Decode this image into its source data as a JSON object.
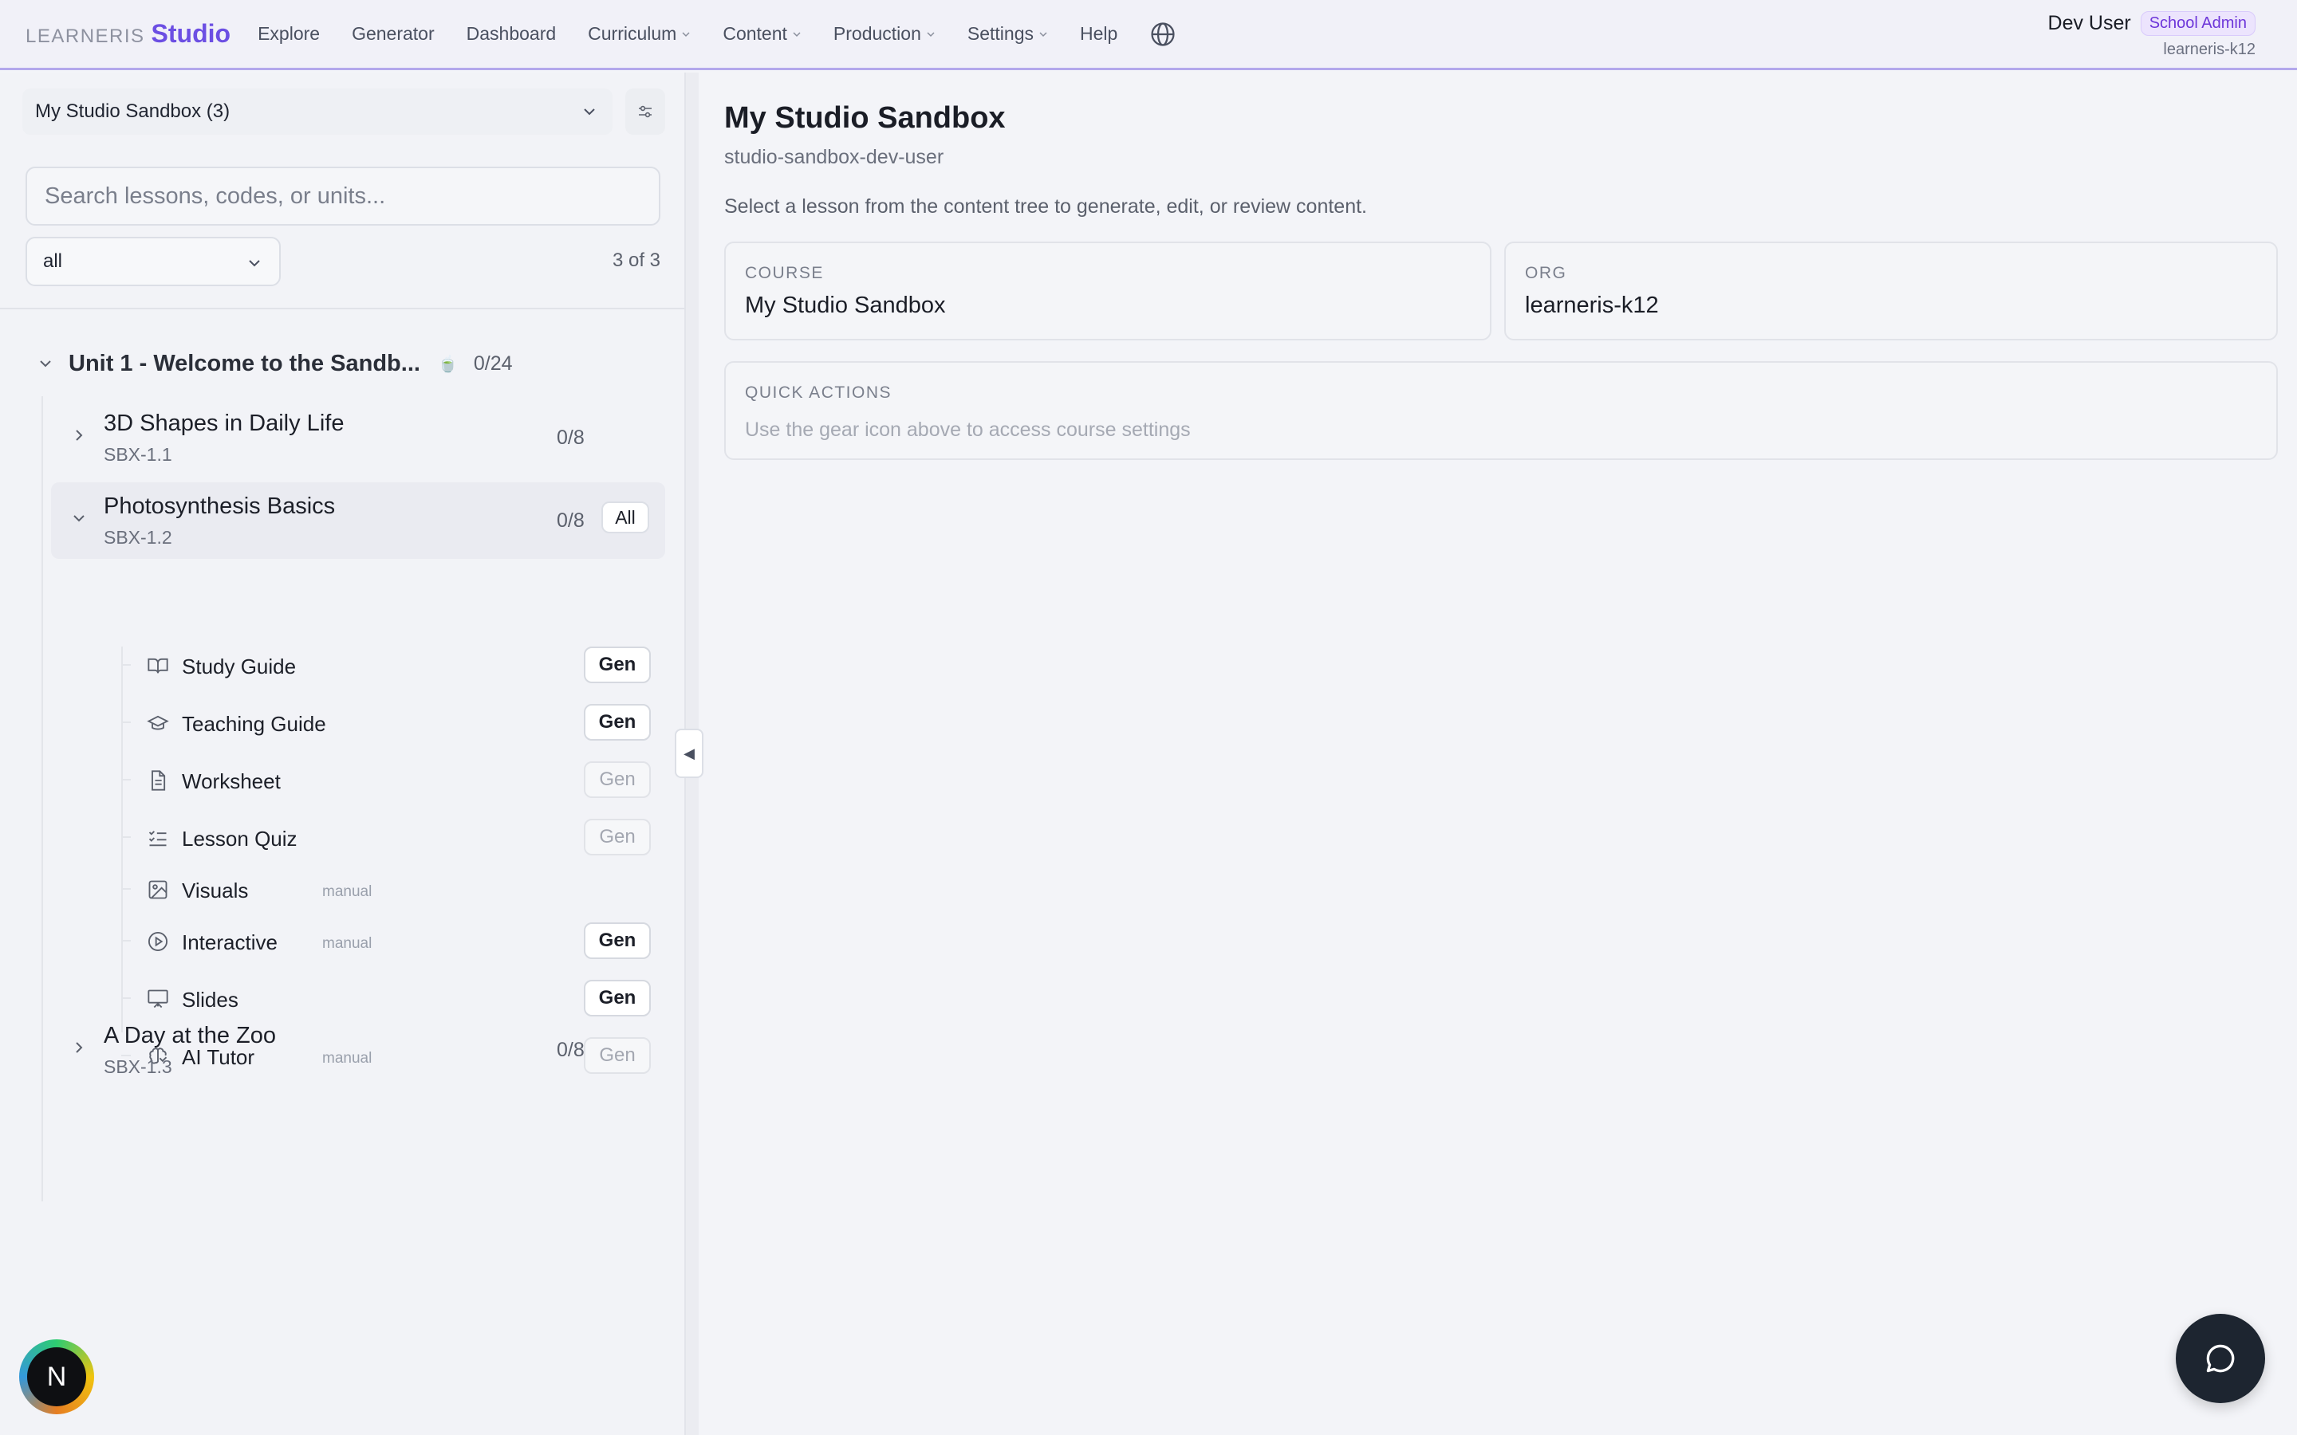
{
  "brand": {
    "prefix": "LEARNERIS",
    "name": "Studio",
    "accent": "#6c4fe3"
  },
  "nav": {
    "items": [
      {
        "label": "Explore",
        "dropdown": false
      },
      {
        "label": "Generator",
        "dropdown": false
      },
      {
        "label": "Dashboard",
        "dropdown": false
      },
      {
        "label": "Curriculum",
        "dropdown": true
      },
      {
        "label": "Content",
        "dropdown": true
      },
      {
        "label": "Production",
        "dropdown": true
      },
      {
        "label": "Settings",
        "dropdown": true
      },
      {
        "label": "Help",
        "dropdown": false
      }
    ],
    "language_icon": "globe-icon"
  },
  "user": {
    "name": "Dev User",
    "role": "School Admin",
    "org": "learneris-k12"
  },
  "sidebar": {
    "course_select": "My Studio Sandbox (3)",
    "search_placeholder": "Search lessons, codes, or units...",
    "status_filter": "all",
    "count": "3 of 3",
    "unit": {
      "title": "Unit 1 - Welcome to the Sandb...",
      "emoji": "🍵",
      "progress": "0/24"
    },
    "lessons": [
      {
        "title": "3D Shapes in Daily Life",
        "code": "SBX-1.1",
        "progress": "0/8",
        "expanded": false
      },
      {
        "title": "Photosynthesis Basics",
        "code": "SBX-1.2",
        "progress": "0/8",
        "expanded": true,
        "all_label": "All"
      },
      {
        "title": "A Day at the Zoo",
        "code": "SBX-1.3",
        "progress": "0/8",
        "expanded": false
      }
    ],
    "content_types": [
      {
        "label": "Study Guide",
        "icon": "book-open-icon",
        "manual": "",
        "gen": "Gen",
        "gen_enabled": true
      },
      {
        "label": "Teaching Guide",
        "icon": "graduation-cap-icon",
        "manual": "",
        "gen": "Gen",
        "gen_enabled": true
      },
      {
        "label": "Worksheet",
        "icon": "file-text-icon",
        "manual": "",
        "gen": "Gen",
        "gen_enabled": false
      },
      {
        "label": "Lesson Quiz",
        "icon": "list-checks-icon",
        "manual": "",
        "gen": "Gen",
        "gen_enabled": false
      },
      {
        "label": "Visuals",
        "icon": "image-icon",
        "manual": "manual",
        "gen": "",
        "gen_enabled": false
      },
      {
        "label": "Interactive",
        "icon": "play-circle-icon",
        "manual": "manual",
        "gen": "Gen",
        "gen_enabled": true
      },
      {
        "label": "Slides",
        "icon": "presentation-icon",
        "manual": "",
        "gen": "Gen",
        "gen_enabled": true
      },
      {
        "label": "AI Tutor",
        "icon": "brain-icon",
        "manual": "manual",
        "gen": "Gen",
        "gen_enabled": false
      }
    ],
    "collapse_glyph": "◀"
  },
  "main": {
    "title": "My Studio Sandbox",
    "subtitle": "studio-sandbox-dev-user",
    "help_text": "Select a lesson from the content tree to generate, edit, or review content.",
    "course_card": {
      "label": "COURSE",
      "value": "My Studio Sandbox"
    },
    "org_card": {
      "label": "ORG",
      "value": "learneris-k12"
    },
    "quick_actions": {
      "label": "QUICK ACTIONS",
      "hint": "Use the gear icon above to access course settings"
    }
  },
  "avatar_initial": "N"
}
